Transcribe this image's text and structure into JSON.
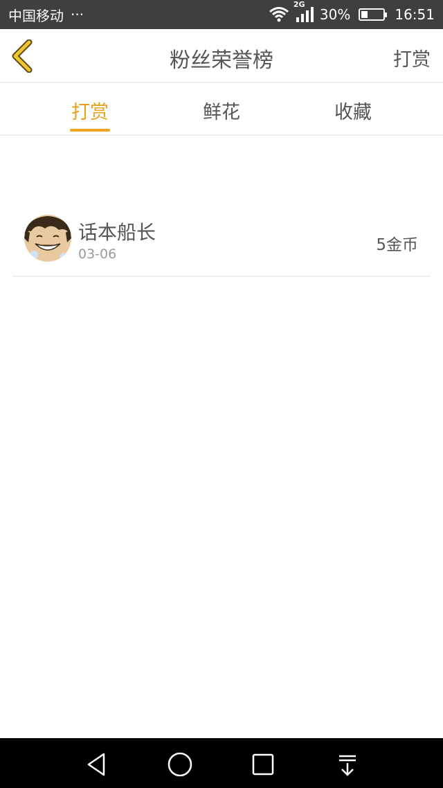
{
  "status_bar": {
    "carrier": "中国移动",
    "dots": "···",
    "network": "2G",
    "battery_percent": "30%",
    "battery_level": 0.3,
    "time": "16:51"
  },
  "header": {
    "title": "粉丝荣誉榜",
    "right_action": "打赏"
  },
  "tabs": [
    {
      "label": "打赏",
      "active": true
    },
    {
      "label": "鲜花",
      "active": false
    },
    {
      "label": "收藏",
      "active": false
    }
  ],
  "list": [
    {
      "name": "话本船长",
      "date": "03-06",
      "amount": "5金币"
    }
  ],
  "colors": {
    "accent": "#f0a51d",
    "text": "#555555",
    "subtext": "#9a9a9a",
    "divider": "#eeeeee"
  }
}
